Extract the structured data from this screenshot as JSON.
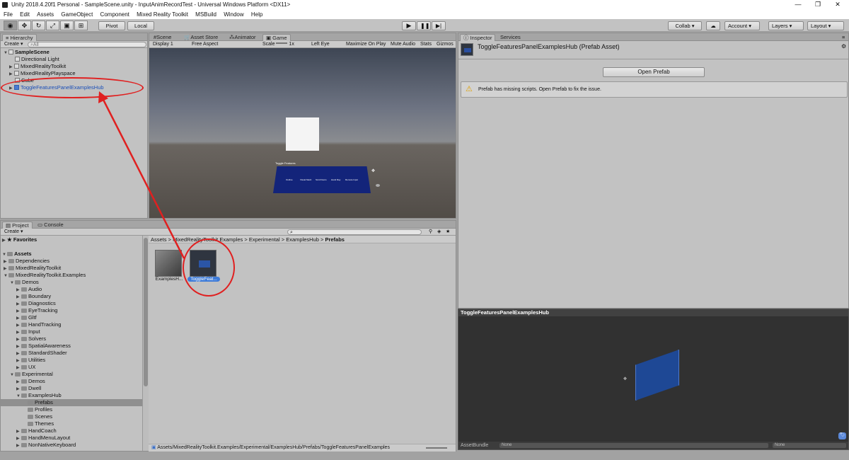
{
  "window": {
    "title": "Unity 2018.4.20f1 Personal - SampleScene.unity - InputAnimRecordTest - Universal Windows Platform <DX11>"
  },
  "menu": [
    "File",
    "Edit",
    "Assets",
    "GameObject",
    "Component",
    "Mixed Reality Toolkit",
    "MSBuild",
    "Window",
    "Help"
  ],
  "toolbar": {
    "pivot": "Pivot",
    "local": "Local",
    "collab": "Collab ▾",
    "account": "Account",
    "layers": "Layers",
    "layout": "Layout"
  },
  "hierarchy": {
    "tab": "Hierarchy",
    "create": "Create ▾",
    "search_placeholder": "All",
    "scene": "SampleScene",
    "items": [
      "Directional Light",
      "MixedRealityToolkit",
      "MixedRealityPlayspace",
      "Cube",
      "ToggleFeaturesPanelExamplesHub"
    ]
  },
  "scene_tabs": {
    "scene": "Scene",
    "asset_store": "Asset Store",
    "animator": "Animator",
    "game": "Game"
  },
  "game_bar": {
    "display": "Display 1",
    "aspect": "Free Aspect",
    "scale": "Scale",
    "scale_value": "1x",
    "eye": "Left Eye",
    "maximize": "Maximize On Play",
    "mute": "Mute Audio",
    "stats": "Stats",
    "gizmos": "Gizmos"
  },
  "game_panel": {
    "title": "Toggle Features",
    "buttons": [
      "Outline",
      "Visual Mesh",
      "Scroll Items",
      "Hand Ray",
      "Remote Input"
    ]
  },
  "inspector": {
    "tab": "Inspector",
    "services": "Services",
    "title": "ToggleFeaturesPanelExamplesHub (Prefab Asset)",
    "open_prefab": "Open Prefab",
    "warning": "Prefab has missing scripts. Open Prefab to fix the issue."
  },
  "preview": {
    "title": "ToggleFeaturesPanelExamplesHub",
    "assetbundle": "AssetBundle",
    "none1": "None",
    "none2": "None"
  },
  "project": {
    "tab": "Project",
    "console": "Console",
    "create": "Create ▾",
    "favorites": "Favorites",
    "assets": "Assets",
    "tree": [
      {
        "label": "Dependencies",
        "indent": 1,
        "open": false
      },
      {
        "label": "MixedRealityToolkit",
        "indent": 1,
        "open": false
      },
      {
        "label": "MixedRealityToolkit.Examples",
        "indent": 1,
        "open": true
      },
      {
        "label": "Demos",
        "indent": 2,
        "open": true
      },
      {
        "label": "Audio",
        "indent": 3,
        "open": false
      },
      {
        "label": "Boundary",
        "indent": 3,
        "open": false
      },
      {
        "label": "Diagnostics",
        "indent": 3,
        "open": false
      },
      {
        "label": "EyeTracking",
        "indent": 3,
        "open": false
      },
      {
        "label": "Gltf",
        "indent": 3,
        "open": false
      },
      {
        "label": "HandTracking",
        "indent": 3,
        "open": false
      },
      {
        "label": "Input",
        "indent": 3,
        "open": false
      },
      {
        "label": "Solvers",
        "indent": 3,
        "open": false
      },
      {
        "label": "SpatialAwareness",
        "indent": 3,
        "open": false
      },
      {
        "label": "StandardShader",
        "indent": 3,
        "open": false
      },
      {
        "label": "Utilities",
        "indent": 3,
        "open": false
      },
      {
        "label": "UX",
        "indent": 3,
        "open": false
      },
      {
        "label": "Experimental",
        "indent": 2,
        "open": true
      },
      {
        "label": "Demos",
        "indent": 3,
        "open": false
      },
      {
        "label": "Dwell",
        "indent": 3,
        "open": false
      },
      {
        "label": "ExamplesHub",
        "indent": 3,
        "open": true
      },
      {
        "label": "Prefabs",
        "indent": 4,
        "open": null,
        "selected": true
      },
      {
        "label": "Profiles",
        "indent": 4,
        "open": null
      },
      {
        "label": "Scenes",
        "indent": 4,
        "open": null
      },
      {
        "label": "Themes",
        "indent": 4,
        "open": null
      },
      {
        "label": "HandCoach",
        "indent": 3,
        "open": false
      },
      {
        "label": "HandMenuLayout",
        "indent": 3,
        "open": false
      },
      {
        "label": "NonNativeKeyboard",
        "indent": 3,
        "open": false
      }
    ],
    "breadcrumb": [
      "Assets",
      "MixedRealityToolkit.Examples",
      "Experimental",
      "ExamplesHub",
      "Prefabs"
    ],
    "assets_items": [
      {
        "label": "ExamplesH..."
      },
      {
        "label": "ToggleFeat..."
      }
    ],
    "path": "Assets/MixedRealityToolkit.Examples/Experimental/ExamplesHub/Prefabs/ToggleFeaturesPanelExamples"
  }
}
